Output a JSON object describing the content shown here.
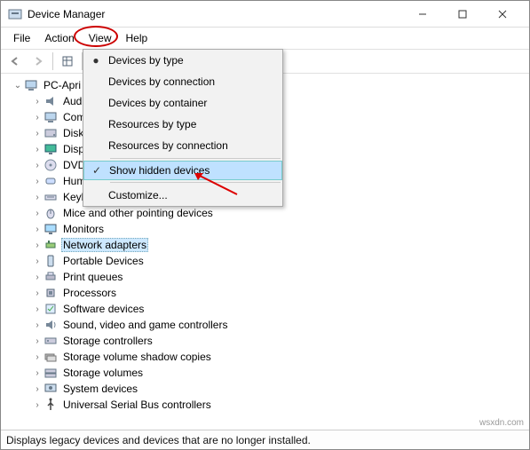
{
  "window": {
    "title": "Device Manager"
  },
  "menubar": [
    "File",
    "Action",
    "View",
    "Help"
  ],
  "dropdown": {
    "items": [
      {
        "label": "Devices by type",
        "mark": "dot"
      },
      {
        "label": "Devices by connection"
      },
      {
        "label": "Devices by container"
      },
      {
        "label": "Resources by type"
      },
      {
        "label": "Resources by connection"
      }
    ],
    "divider_after": 4,
    "hidden_item": {
      "label": "Show hidden devices",
      "mark": "check",
      "selected": true
    },
    "customize": {
      "label": "Customize..."
    }
  },
  "tree": {
    "root": "PC-Apri",
    "children": [
      {
        "label": "Aud",
        "icon": "audio"
      },
      {
        "label": "Com",
        "icon": "computer"
      },
      {
        "label": "Disk",
        "icon": "disk"
      },
      {
        "label": "Disp",
        "icon": "display"
      },
      {
        "label": "DVD",
        "icon": "dvd"
      },
      {
        "label": "Hum",
        "icon": "hid"
      },
      {
        "label": "Keyb",
        "icon": "keyboard"
      },
      {
        "label": "Mice and other pointing devices",
        "icon": "mouse"
      },
      {
        "label": "Monitors",
        "icon": "monitor"
      },
      {
        "label": "Network adapters",
        "icon": "network",
        "selected": true
      },
      {
        "label": "Portable Devices",
        "icon": "portable"
      },
      {
        "label": "Print queues",
        "icon": "printer"
      },
      {
        "label": "Processors",
        "icon": "cpu"
      },
      {
        "label": "Software devices",
        "icon": "software"
      },
      {
        "label": "Sound, video and game controllers",
        "icon": "sound"
      },
      {
        "label": "Storage controllers",
        "icon": "storage"
      },
      {
        "label": "Storage volume shadow copies",
        "icon": "shadow"
      },
      {
        "label": "Storage volumes",
        "icon": "volume"
      },
      {
        "label": "System devices",
        "icon": "system"
      },
      {
        "label": "Universal Serial Bus controllers",
        "icon": "usb"
      }
    ]
  },
  "status": "Displays legacy devices and devices that are no longer installed.",
  "watermark": "wsxdn.com"
}
